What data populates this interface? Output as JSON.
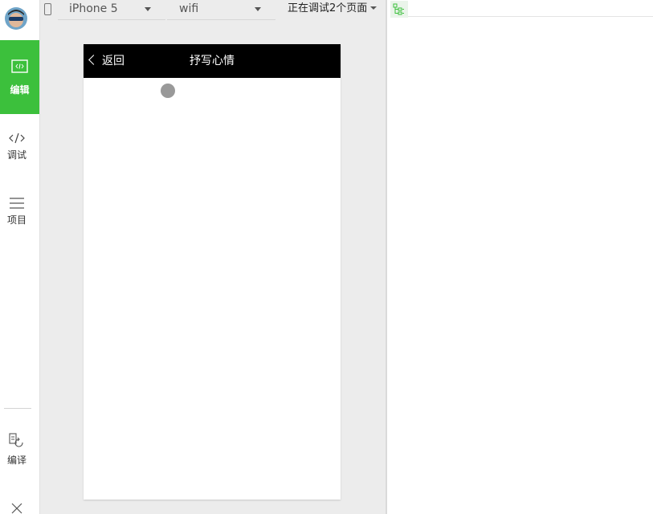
{
  "sidebar": {
    "items": [
      {
        "label": "编辑",
        "icon": "code-box-icon",
        "active": true
      },
      {
        "label": "调试",
        "icon": "code-icon",
        "active": false
      },
      {
        "label": "项目",
        "icon": "menu-icon",
        "active": false
      },
      {
        "label": "编译",
        "icon": "compile-icon",
        "active": false
      }
    ],
    "accent": "#3cc03c"
  },
  "toolbar": {
    "device": "iPhone 5",
    "network": "wifi",
    "debug_pages": "正在调试2个页面"
  },
  "simulator": {
    "back_label": "返回",
    "title": "抒写心情"
  },
  "colors": {
    "navbar_bg": "#000000",
    "background": "#ececec"
  }
}
